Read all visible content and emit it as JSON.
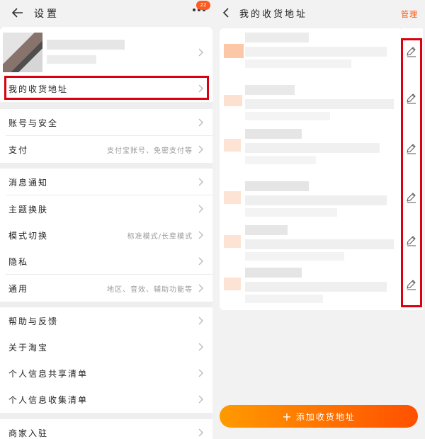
{
  "left": {
    "header": {
      "title": "设置",
      "badge": "22"
    },
    "address_row": {
      "label": "我的收货地址"
    },
    "rows": [
      {
        "label": "账号与安全",
        "extra": ""
      },
      {
        "label": "支付",
        "extra": "支付宝账号、免密支付等"
      },
      {
        "label": "消息通知",
        "extra": ""
      },
      {
        "label": "主题换肤",
        "extra": ""
      },
      {
        "label": "模式切换",
        "extra": "标准模式/长辈模式"
      },
      {
        "label": "隐私",
        "extra": ""
      },
      {
        "label": "通用",
        "extra": "地区、音效、辅助功能等"
      },
      {
        "label": "帮助与反馈",
        "extra": ""
      },
      {
        "label": "关于淘宝",
        "extra": ""
      },
      {
        "label": "个人信息共享清单",
        "extra": ""
      },
      {
        "label": "个人信息收集清单",
        "extra": ""
      },
      {
        "label": "商家入驻",
        "extra": ""
      }
    ]
  },
  "right": {
    "header": {
      "title": "我的收货地址",
      "manage": "管理"
    },
    "add_button": {
      "label": "添加收货地址",
      "plus": "+"
    }
  },
  "colors": {
    "accent": "#ff5000",
    "highlight": "#d9000f",
    "badge": "#ff5a1f"
  }
}
